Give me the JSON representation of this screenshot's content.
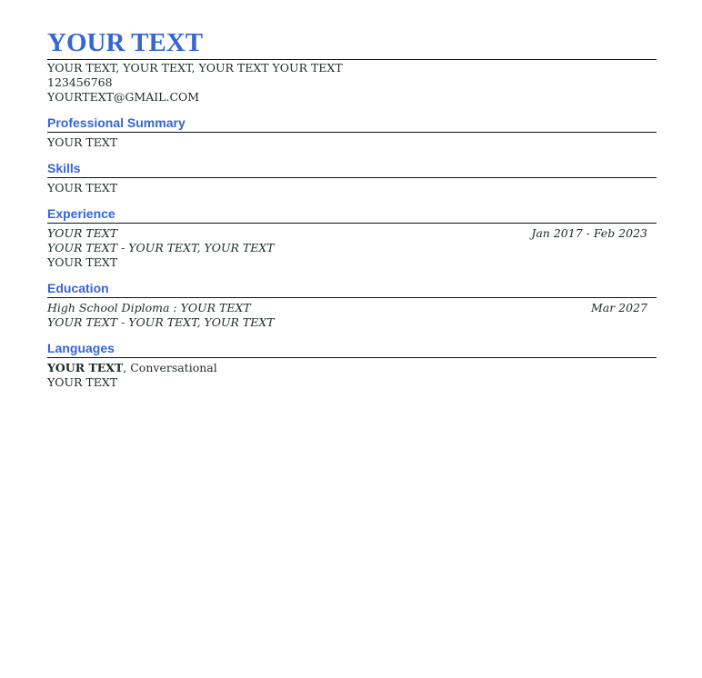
{
  "header": {
    "name": "YOUR TEXT",
    "address": "YOUR TEXT, YOUR TEXT, YOUR TEXT YOUR TEXT",
    "phone": "123456768",
    "email": "YOURTEXT@GMAIL.COM"
  },
  "sections": {
    "summary": {
      "title": "Professional Summary",
      "text": "YOUR TEXT"
    },
    "skills": {
      "title": "Skills",
      "text": "YOUR TEXT"
    },
    "experience": {
      "title": "Experience",
      "job_title": "YOUR TEXT",
      "dates": "Jan 2017 - Feb 2023",
      "company_location": "YOUR TEXT - YOUR TEXT, YOUR TEXT",
      "description": "YOUR TEXT"
    },
    "education": {
      "title": "Education",
      "degree_label": "High School Diploma : ",
      "degree_field": "YOUR TEXT",
      "date": "Mar 2027",
      "school_location": "YOUR TEXT - YOUR TEXT, YOUR TEXT"
    },
    "languages": {
      "title": "Languages",
      "language": "YOUR TEXT",
      "level": ", Conversational",
      "extra": "YOUR TEXT"
    }
  },
  "colors": {
    "accent": "#3565d6",
    "text": "#1f2a2a",
    "rule": "#111111"
  }
}
